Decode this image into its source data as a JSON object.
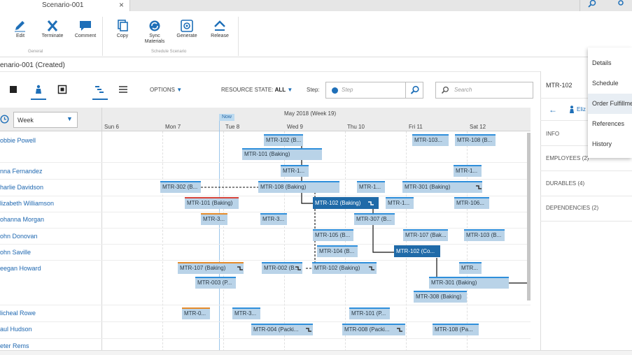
{
  "tab": {
    "title": "Scenario-001"
  },
  "ribbon": {
    "general_group": "General",
    "schedule_group": "Schedule Scenario",
    "buttons": {
      "edit": "Edit",
      "terminate": "Terminate",
      "comment": "Comment",
      "copy": "Copy",
      "sync_l1": "Sync",
      "sync_l2": "Materials",
      "generate": "Generate",
      "release": "Release"
    }
  },
  "scenario": {
    "title": "enario-001  (Created)"
  },
  "toolbar": {
    "options_label": "OPTIONS",
    "resource_state_label": "RESOURCE STATE:",
    "resource_state_value": "ALL",
    "step_label": "Step:",
    "step_placeholder": "Step",
    "search_placeholder": "Search"
  },
  "grid": {
    "period": "Week",
    "month_header": "May 2018  (Week 19)",
    "now_label": "Now",
    "days": [
      "Sun 6",
      "Mon 7",
      "Tue 8",
      "Wed 9",
      "Thu 10",
      "Fri 11",
      "Sat 12"
    ],
    "people": [
      "obbie Powell",
      "nna Fernandez",
      "harlie Davidson",
      "lizabeth Williamson",
      "ohanna Morgan",
      "ohn Donovan",
      "ohn Saville",
      "eegan Howard",
      "licheal Rowe",
      "aul Hudson",
      "eter Rems"
    ],
    "tasks": {
      "t1": "MTR-102 (B...",
      "t2": "MTR-101 (Baking)",
      "t3": "MTR-103...",
      "t4": "MTR-108 (B...",
      "t5": "MTR-1...",
      "t6": "MTR-1...",
      "t7": "MTR-302 (B...",
      "t8": "MTR-108 (Baking)",
      "t9": "MTR-1...",
      "t10": "MTR-301 (Baking)",
      "t11": "MTR-101 (Baking)",
      "t12": "MTR-102 (Baking)",
      "t13": "MTR-1...",
      "t14": "MTR-106...",
      "t15": "MTR-3...",
      "t16": "MTR-3...",
      "t17": "MTR-307 (B...",
      "t18": "MTR-105 (B...",
      "t19": "MTR-107 (Bak...",
      "t20": "MTR-103 (B...",
      "t21": "MTR-104 (B...",
      "t22": "MTR-102 (Co...",
      "t23": "MTR-107 (Baking)",
      "t24": "MTR-002 (B...",
      "t25": "MTR-102 (Baking)",
      "t26": "MTR...",
      "t27": "MTR-003 (P...",
      "t28": "MTR-301 (Baking)",
      "t29": "MTR-308 (Baking)",
      "t30": "MTR-0...",
      "t31": "MTR-3...",
      "t32": "MTR-101 (P...",
      "t33": "MTR-004 (Packi...",
      "t34": "MTR-008 (Packi...",
      "t35": "MTR-108 (Pa..."
    }
  },
  "right_panel": {
    "title": "MTR-102",
    "person": "Eliz",
    "sections": [
      "INFO",
      "EMPLOYEES (2)",
      "DURABLES (4)",
      "DEPENDENCIES (2)"
    ]
  },
  "menu": {
    "items": [
      "Details",
      "Schedule",
      "Order Fulfillment",
      "References",
      "History"
    ]
  },
  "colors": {
    "accent": "#1f6aa8",
    "task_fill": "#b9d3e8",
    "link": "#1e67b0"
  }
}
